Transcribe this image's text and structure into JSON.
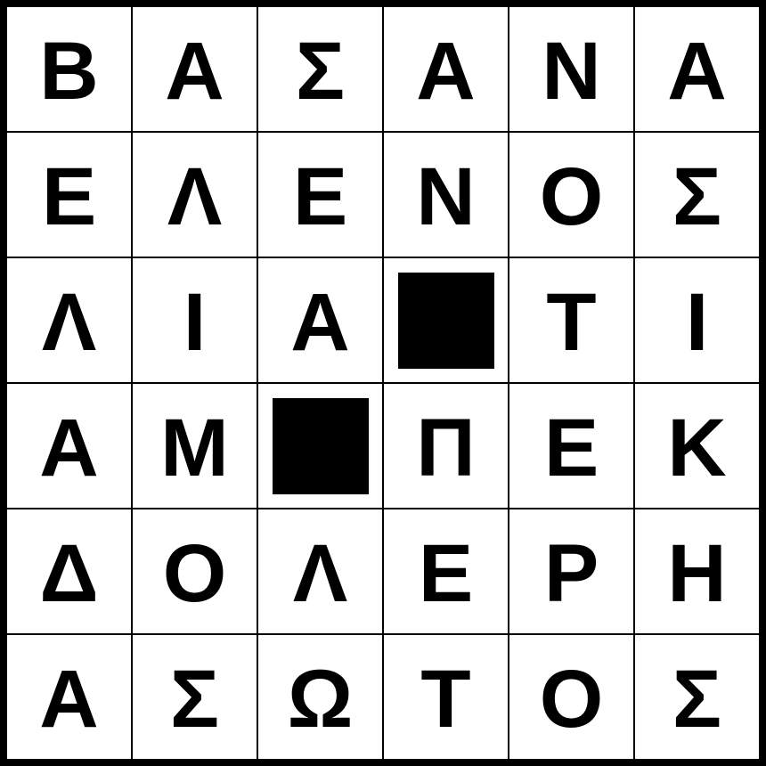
{
  "puzzle": {
    "rows": [
      [
        "Β",
        "Α",
        "Σ",
        "Α",
        "Ν",
        "Α"
      ],
      [
        "Ε",
        "Λ",
        "Ε",
        "Ν",
        "Ο",
        "Σ"
      ],
      [
        "Λ",
        "Ι",
        "Α",
        "",
        "Τ",
        "Ι"
      ],
      [
        "Α",
        "Μ",
        "",
        "Π",
        "Ε",
        "Κ"
      ],
      [
        "Δ",
        "Ο",
        "Λ",
        "Ε",
        "Ρ",
        "Η"
      ],
      [
        "Α",
        "Σ",
        "Ω",
        "Τ",
        "Ο",
        "Σ"
      ]
    ],
    "blocked": [
      [
        2,
        3
      ],
      [
        3,
        2
      ]
    ],
    "colors": {
      "grid_line": "#000000",
      "cell_bg": "#ffffff",
      "letter": "#000000",
      "block": "#000000"
    }
  }
}
